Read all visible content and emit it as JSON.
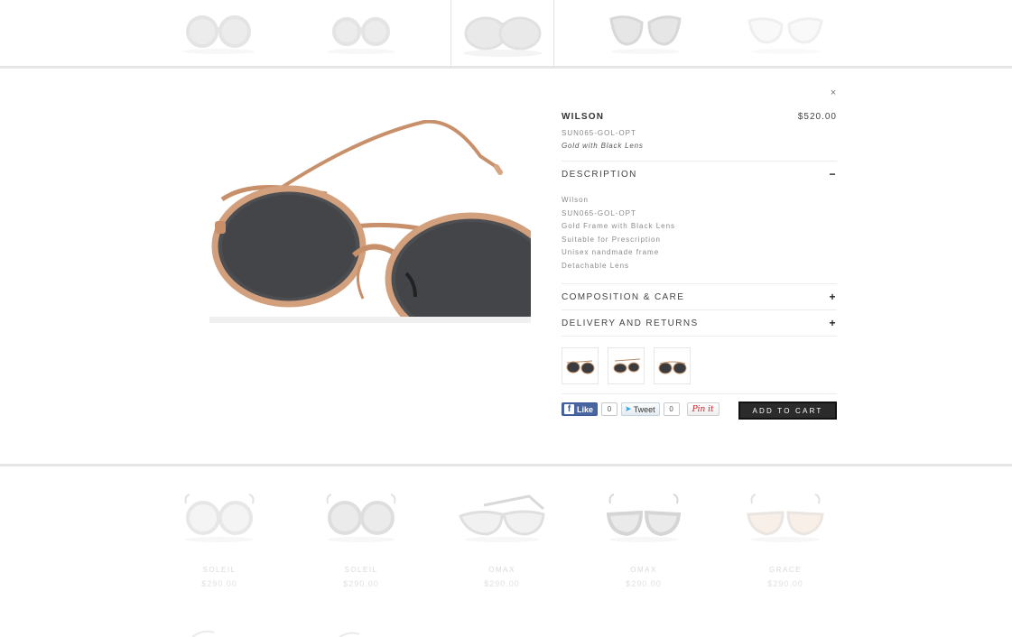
{
  "top_strip": {
    "items": [
      {
        "name": "Round frosted frames"
      },
      {
        "name": "Round frosted frames"
      },
      {
        "name": "Round silver frames (selected)"
      },
      {
        "name": "Cat eye grey"
      },
      {
        "name": "Cat eye white"
      }
    ]
  },
  "quick_view": {
    "close_label": "×",
    "product_name": "WILSON",
    "price": "$520.00",
    "sku": "SUN065-GOL-OPT",
    "variant": "Gold with Black Lens",
    "description": {
      "title": "DESCRIPTION",
      "toggle": "−",
      "lines": [
        "Wilson",
        "SUN065-GOL-OPT",
        "Gold Frame with Black Lens",
        "Suitable for Prescription",
        "Unisex nandmade frame",
        "Detachable Lens"
      ]
    },
    "composition": {
      "title": "COMPOSITION & CARE",
      "toggle": "+"
    },
    "delivery": {
      "title": "DELIVERY AND RETURNS",
      "toggle": "+"
    },
    "social": {
      "like_label": "Like",
      "like_count": "0",
      "tweet_label": "Tweet",
      "tweet_count": "0",
      "pin_label": "Pin it"
    },
    "add_to_cart_label": "ADD TO CART"
  },
  "grid": {
    "items": [
      {
        "name": "SOLEIL",
        "price": "$290.00"
      },
      {
        "name": "SOLEIL",
        "price": "$290.00"
      },
      {
        "name": "OMAX",
        "price": "$290.00"
      },
      {
        "name": "OMAX",
        "price": "$290.00"
      },
      {
        "name": "GRACE",
        "price": "$290.00"
      }
    ]
  },
  "colors": {
    "accent_dark": "#2b2b2b",
    "facebook_blue": "#3b5898",
    "pinterest_red": "#cb2027",
    "frame_gold": "#c9966e",
    "lens_dark": "#3a3b3e"
  }
}
